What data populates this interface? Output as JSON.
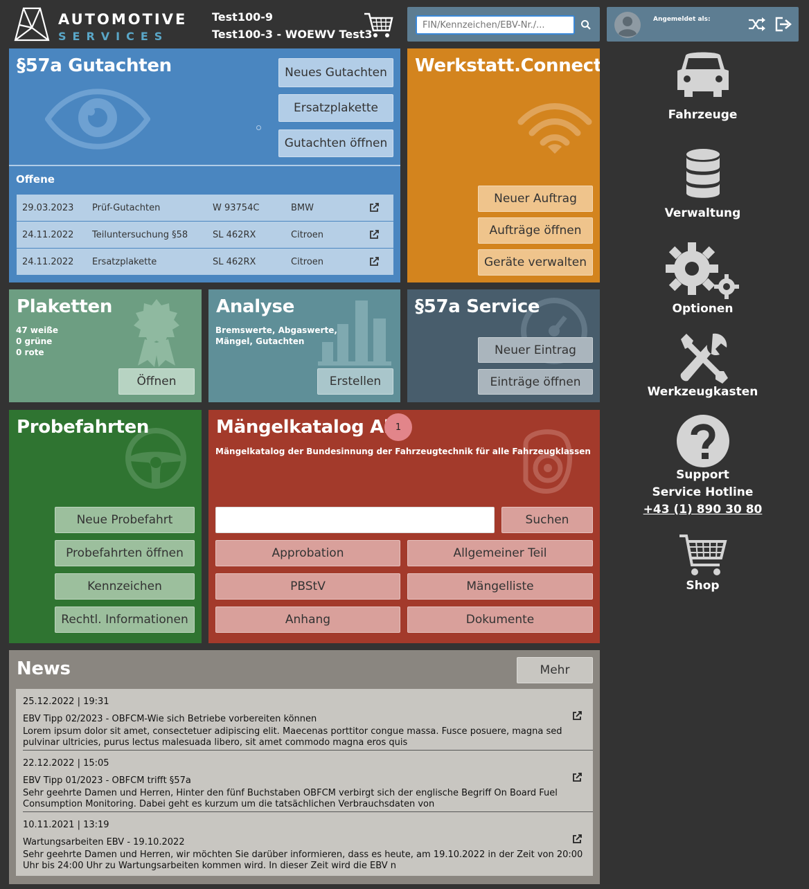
{
  "header": {
    "logo_line1": "AUTOMOTIVE",
    "logo_line2": "SERVICES",
    "account_line1": "Test100-9",
    "account_line2": "Test100-3 - WOEWV Test3",
    "search_placeholder": "FIN/Kennzeichen/EBV-Nr./...",
    "logged_in_label": "Angemeldet als:"
  },
  "gutachten": {
    "title": "§57a Gutachten",
    "btn_new": "Neues Gutachten",
    "btn_plakette": "Ersatzplakette",
    "btn_open": "Gutachten öffnen",
    "open_label": "Offene",
    "rows": [
      {
        "date": "29.03.2023",
        "type": "Prüf-Gutachten",
        "plate": "W 93754C",
        "make": "BMW"
      },
      {
        "date": "24.11.2022",
        "type": "Teiluntersuchung §58",
        "plate": "SL 462RX",
        "make": "Citroen"
      },
      {
        "date": "24.11.2022",
        "type": "Ersatzplakette",
        "plate": "SL 462RX",
        "make": "Citroen"
      }
    ]
  },
  "werkstatt": {
    "title": "Werkstatt.Connect",
    "btn_new": "Neuer Auftrag",
    "btn_open": "Aufträge öffnen",
    "btn_devices": "Geräte verwalten"
  },
  "plaketten": {
    "title": "Plaketten",
    "line1": "47 weiße",
    "line2": "0 grüne",
    "line3": "0 rote",
    "btn": "Öffnen"
  },
  "analyse": {
    "title": "Analyse",
    "line1": "Bremswerte, Abgaswerte,",
    "line2": "Mängel, Gutachten",
    "btn": "Erstellen"
  },
  "service": {
    "title": "§57a Service",
    "btn_new": "Neuer Eintrag",
    "btn_open": "Einträge öffnen"
  },
  "probefahrten": {
    "title": "Probefahrten",
    "btn_new": "Neue Probefahrt",
    "btn_open": "Probefahrten öffnen",
    "btn_plates": "Kennzeichen",
    "btn_legal": "Rechtl. Informationen"
  },
  "maengel": {
    "title": "Mängelkatalog Abo",
    "badge": "1",
    "subtitle": "Mängelkatalog der Bundesinnung der Fahrzeugtechnik für alle Fahrzeugklassen",
    "search_value": "",
    "btn_search": "Suchen",
    "btn_approbation": "Approbation",
    "btn_allgemein": "Allgemeiner Teil",
    "btn_pbstv": "PBStV",
    "btn_liste": "Mängelliste",
    "btn_anhang": "Anhang",
    "btn_dokumente": "Dokumente"
  },
  "news": {
    "title": "News",
    "btn_more": "Mehr",
    "items": [
      {
        "date": "25.12.2022 | 19:31",
        "title": "EBV Tipp 02/2023 - OBFCM-Wie sich Betriebe vorbereiten können",
        "body": "Lorem ipsum dolor sit amet, consectetuer adipiscing elit. Maecenas porttitor congue massa. Fusce posuere, magna sed pulvinar ultricies, purus lectus malesuada libero, sit amet commodo magna eros quis"
      },
      {
        "date": "22.12.2022 | 15:05",
        "title": "EBV Tipp 01/2023 - OBFCM trifft §57a",
        "body": "Sehr geehrte Damen und Herren, Hinter den fünf Buchstaben OBFCM verbirgt sich der englische Begriff On Board Fuel Consumption Monitoring. Dabei geht es kurzum um die tatsächlichen Verbrauchsdaten von"
      },
      {
        "date": "10.11.2021 | 13:19",
        "title": "Wartungsarbeiten EBV - 19.10.2022",
        "body": "Sehr geehrte Damen und Herren, wir möchten Sie darüber informieren, dass es heute, am 19.10.2022 in der Zeit von 20:00 Uhr bis 24:00 Uhr zu Wartungsarbeiten kommen wird. In dieser Zeit wird die EBV n"
      }
    ]
  },
  "sidebar": {
    "fahrzeuge": "Fahrzeuge",
    "verwaltung": "Verwaltung",
    "optionen": "Optionen",
    "werkzeugkasten": "Werkzeugkasten",
    "support": "Support",
    "hotline": "Service Hotline",
    "phone": "+43 (1) 890 30 80",
    "shop": "Shop"
  },
  "colors": {
    "blue": "#4a86c0",
    "orange": "#d3841e",
    "sage": "#6d9e82",
    "teal": "#5f8f98",
    "slate": "#485d6c",
    "green": "#2f7431",
    "red": "#a33a2b",
    "gray": "#8a8680"
  }
}
